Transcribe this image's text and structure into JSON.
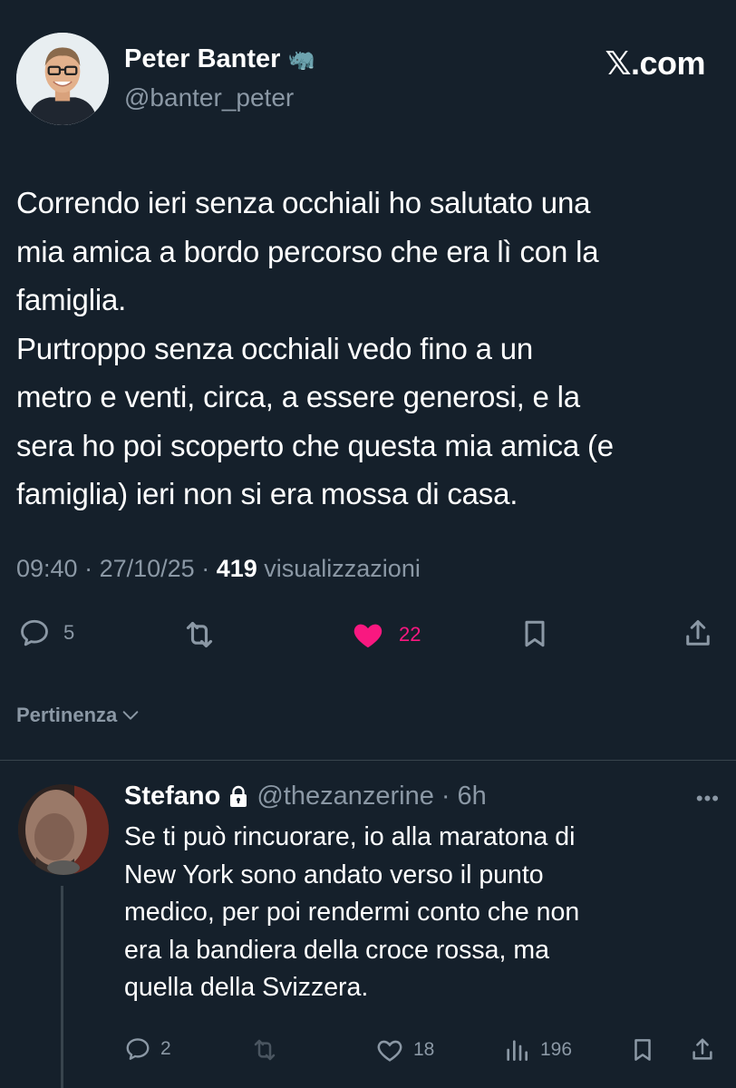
{
  "header": {
    "display_name": "Peter Banter",
    "name_emoji": "🦏",
    "handle": "@banter_peter",
    "brand": "𝕏.com"
  },
  "tweet": {
    "text": "Correndo ieri senza occhiali ho salutato una\nmia amica a bordo percorso che era lì con la\nfamiglia.\nPurtroppo senza occhiali vedo fino a un\nmetro e venti, circa, a essere generosi, e la\nsera ho poi scoperto che questa mia amica (e\nfamiglia) ieri non si era mossa di casa.",
    "time": "09:40",
    "date": "27/10/25",
    "views_count": "419",
    "views_label": "visualizzazioni",
    "separator": " · "
  },
  "actions": {
    "replies": "5",
    "likes": "22",
    "like_color": "#f91880"
  },
  "filter": {
    "label": "Pertinenza"
  },
  "reply": {
    "display_name": "Stefano",
    "handle": "@thezanzerine",
    "age": "6h",
    "separator": "·",
    "more": "•••",
    "text": "Se ti può rincuorare, io alla maratona di\nNew York sono andato verso il punto\nmedico, per poi rendermi conto che non\nera la bandiera della croce rossa, ma\nquella della Svizzera.",
    "replies": "2",
    "likes": "18",
    "views": "196"
  },
  "colors": {
    "background": "#15202b",
    "secondary_text": "#8b98a5",
    "divider": "#38444d"
  }
}
